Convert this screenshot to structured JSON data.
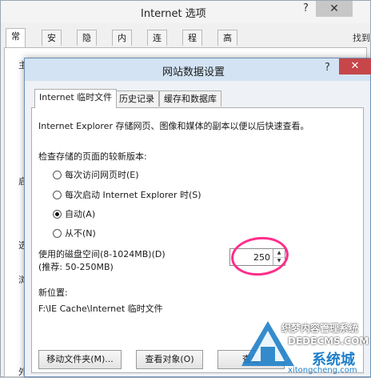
{
  "back_window": {
    "title": "Internet 选项",
    "help": "?",
    "close": "✕",
    "tabs": [
      "常规",
      "安全",
      "隐私",
      "内容",
      "连接",
      "程序",
      "高级"
    ],
    "edge_text": {
      "right_top": "找到",
      "left_1": "主",
      "left_2": "启",
      "left_3": "选",
      "left_4": "浏",
      "left_5": "外"
    }
  },
  "dialog": {
    "title": "网站数据设置",
    "help": "?",
    "close": "✕",
    "tabs": [
      "Internet 临时文件",
      "历史记录",
      "缓存和数据库"
    ],
    "description": "Internet Explorer 存储网页、图像和媒体的副本以便以后快速查看。",
    "check_label": "检查存储的页面的较新版本:",
    "radio_options": [
      {
        "label": "每次访问网页时(E)",
        "checked": false
      },
      {
        "label": "每次启动 Internet Explorer 时(S)",
        "checked": false
      },
      {
        "label": "自动(A)",
        "checked": true
      },
      {
        "label": "从不(N)",
        "checked": false
      }
    ],
    "disk_label": "使用的磁盘空间(8-1024MB)(D)",
    "disk_hint": "(推荐: 50-250MB)",
    "disk_value": "250",
    "location_label": "新位置:",
    "location_path": "F:\\IE Cache\\Internet 临时文件",
    "buttons": {
      "move_folder": "移动文件夹(M)...",
      "view_objects": "查看对象(O)",
      "view_files": "查看"
    }
  },
  "watermark": {
    "line1": "织梦内容管理系统",
    "line2": "DEDECMS.COM",
    "line3": "系统城",
    "line4": "xitongcheng.com"
  },
  "colors": {
    "highlight_circle": "#ff2d8a",
    "dialog_titlebar": "#d3e3f3",
    "close_red": "#c7464a"
  }
}
